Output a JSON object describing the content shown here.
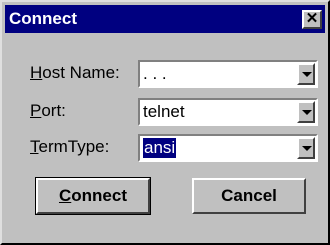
{
  "window": {
    "title": "Connect",
    "close_glyph": "✕"
  },
  "fields": [
    {
      "label_mnemonic": "H",
      "label_rest": "ost Name:",
      "value": ". . ."
    },
    {
      "label_mnemonic": "P",
      "label_rest": "ort:",
      "value": "telnet"
    },
    {
      "label_mnemonic": "T",
      "label_rest": "ermType:",
      "value": "ansi"
    }
  ],
  "buttons": {
    "connect_mnemonic": "C",
    "connect_rest": "onnect",
    "cancel_label": "Cancel"
  },
  "icons": [
    "close-icon",
    "dropdown-arrow-icon"
  ],
  "colors": {
    "titlebar": "#000080",
    "face": "#c0c0c0",
    "selection": "#000080"
  }
}
